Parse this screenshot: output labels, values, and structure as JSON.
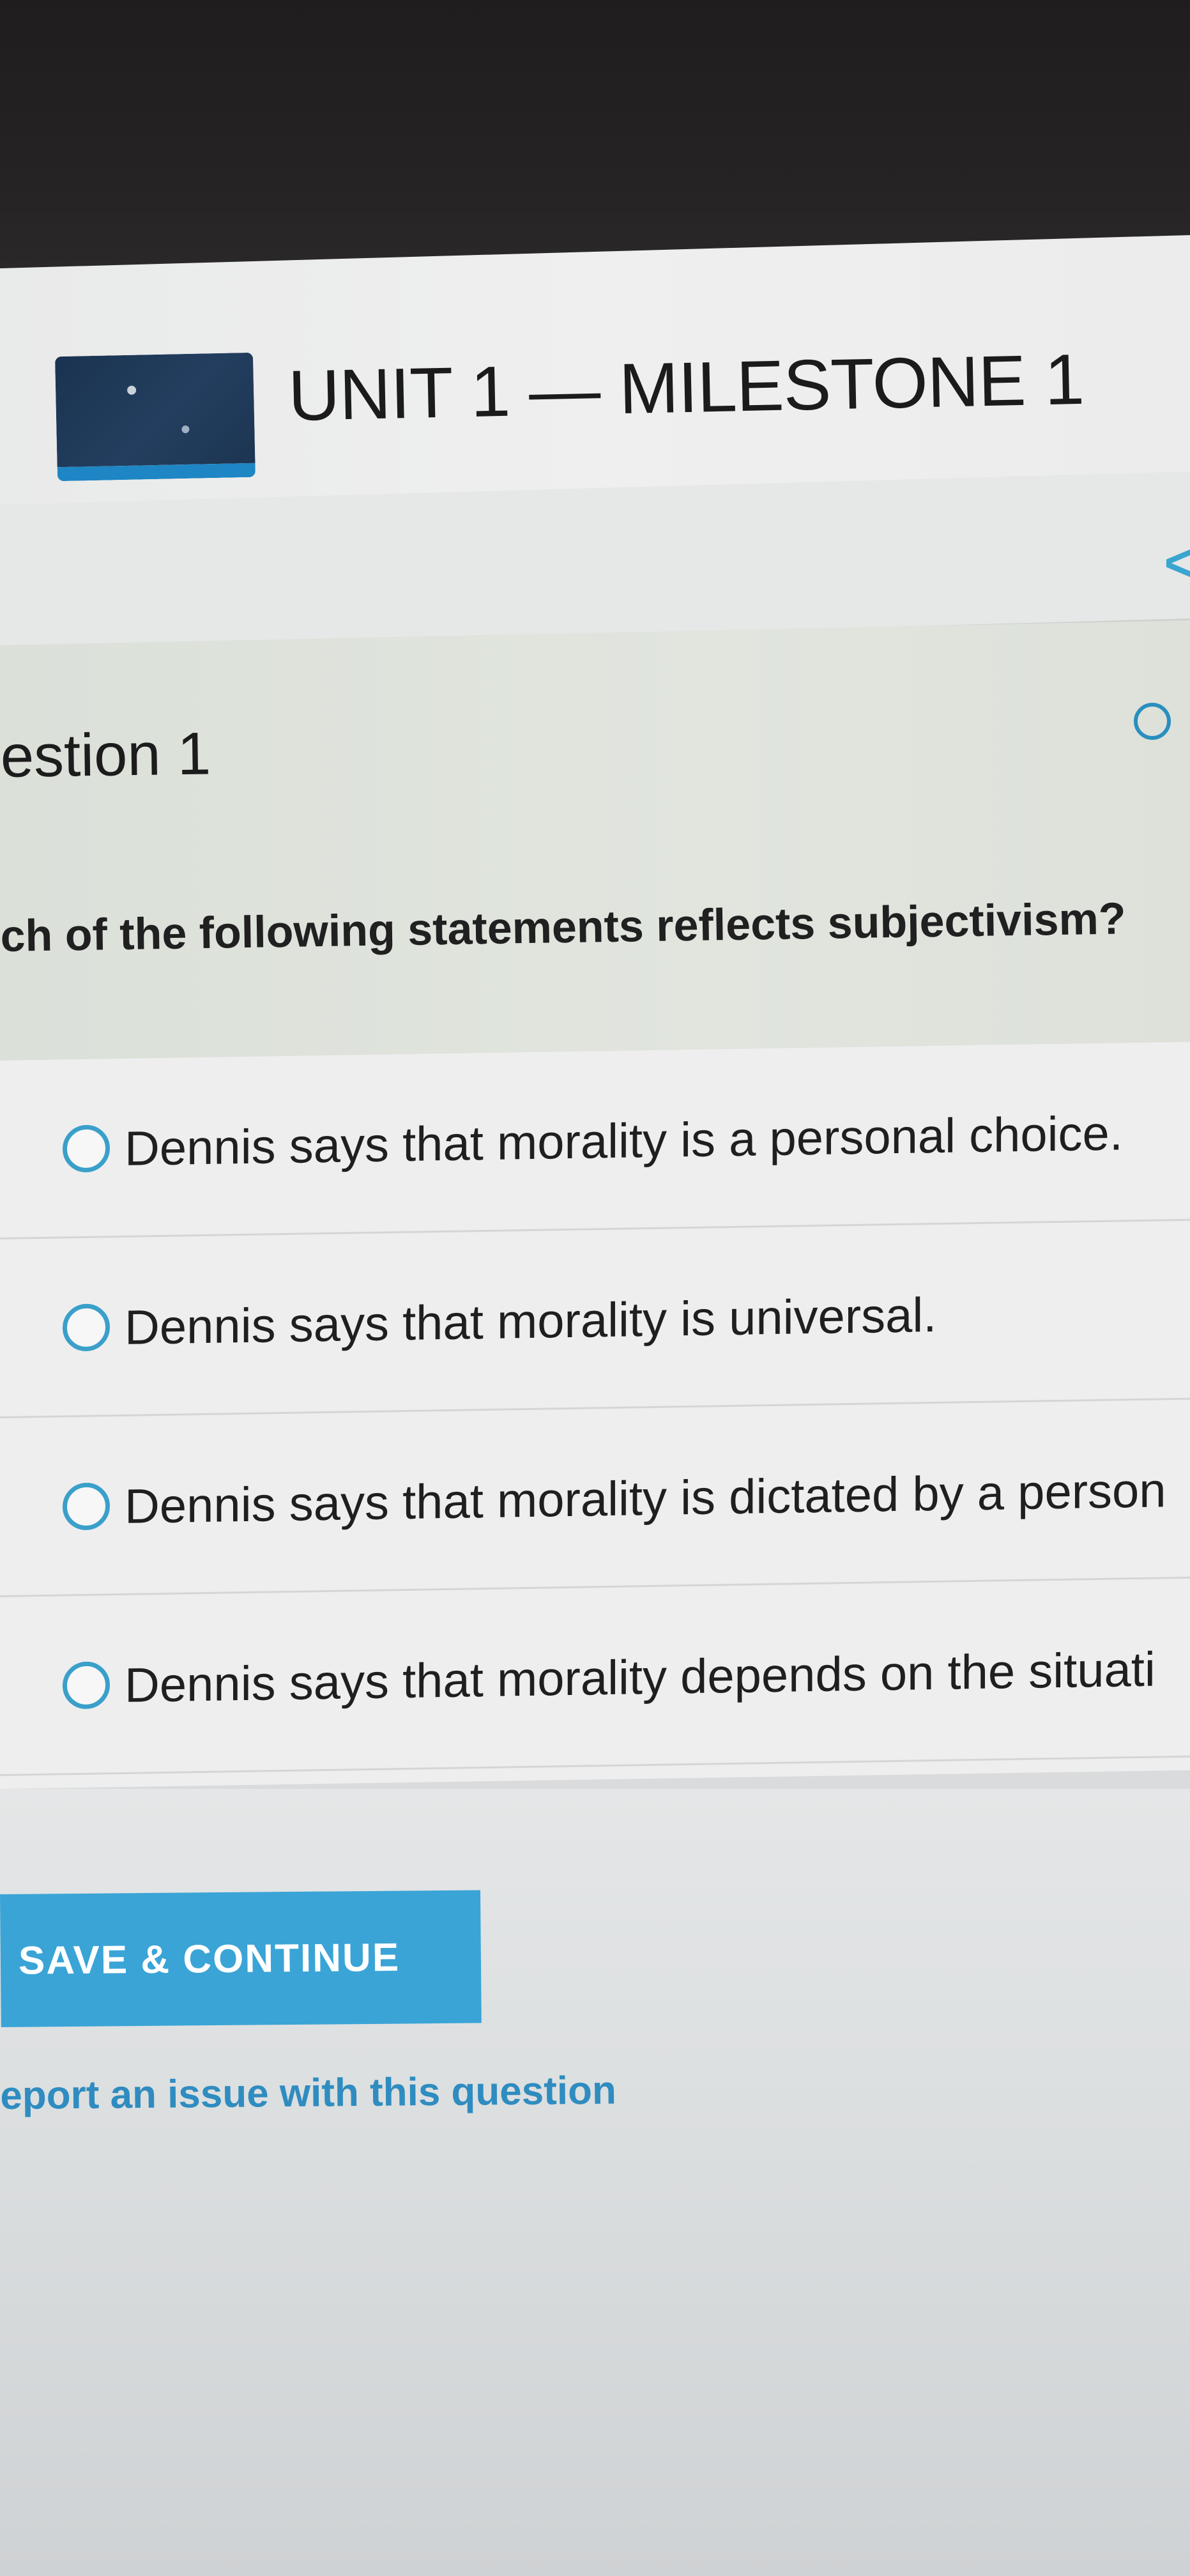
{
  "header": {
    "title": "UNIT 1 — MILESTONE 1"
  },
  "nav": {
    "prev_icon": "chevron-left-icon",
    "prev_glyph": "<"
  },
  "question": {
    "heading": "estion 1",
    "text": "ch of the following statements reflects subjectivism?",
    "status_icon": "circle-outline-icon"
  },
  "options": [
    {
      "label": "Dennis says that morality is a personal choice."
    },
    {
      "label": "Dennis says that morality is universal."
    },
    {
      "label": "Dennis says that morality is dictated by a person"
    },
    {
      "label": "Dennis says that morality depends on the situati"
    }
  ],
  "actions": {
    "save_label": "SAVE & CONTINUE",
    "report_label": "eport an issue with this question"
  },
  "colors": {
    "accent": "#3aa4d6",
    "link": "#2f8cc0",
    "logo_bg": "#1a3350"
  }
}
